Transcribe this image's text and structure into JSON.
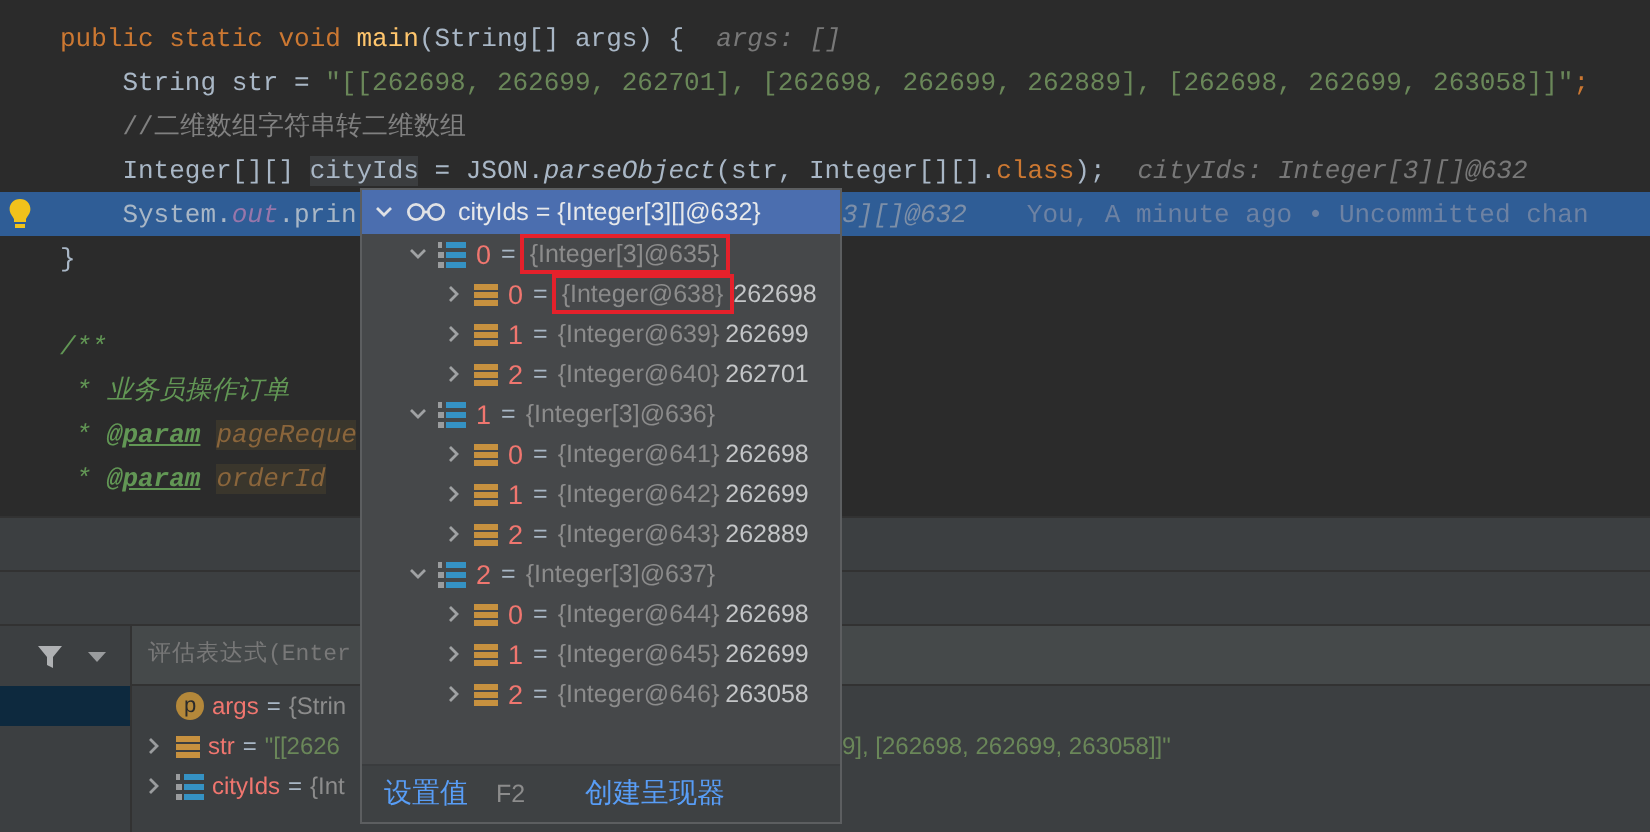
{
  "editor": {
    "lines": [
      {
        "current": false,
        "bulb": false,
        "segments": [
          {
            "text": "public static void ",
            "kind": "kw"
          },
          {
            "text": "main",
            "kind": "fn"
          },
          {
            "text": "(String[] args) {",
            "kind": "plain"
          },
          {
            "text": "args: []",
            "kind": "hint"
          }
        ]
      },
      {
        "current": false,
        "bulb": false,
        "segments": [
          {
            "text": "    String str = ",
            "kind": "plain"
          },
          {
            "text": "\"[[262698, 262699, 262701], [262698, 262699, 262889], [262698, 262699, 263058]]\"",
            "kind": "str"
          },
          {
            "text": ";",
            "kind": "kw"
          }
        ]
      },
      {
        "current": false,
        "bulb": false,
        "segments": [
          {
            "text": "    //二维数组字符串转二维数组",
            "kind": "comment"
          }
        ]
      },
      {
        "current": false,
        "bulb": false,
        "segments": [
          {
            "text": "    Integer[][] ",
            "kind": "plain"
          },
          {
            "text": "cityIds",
            "kind": "ref"
          },
          {
            "text": " = JSON.",
            "kind": "plain"
          },
          {
            "text": "parseObject",
            "kind": "italic"
          },
          {
            "text": "(str, Integer[][].",
            "kind": "plain"
          },
          {
            "text": "class",
            "kind": "kw"
          },
          {
            "text": ");",
            "kind": "plain"
          },
          {
            "text": "cityIds: Integer[3][]@632",
            "kind": "hint"
          }
        ]
      },
      {
        "current": true,
        "bulb": true,
        "segments": [
          {
            "text": "    System.",
            "kind": "plain"
          },
          {
            "text": "out",
            "kind": "field"
          },
          {
            "text": ".prin",
            "kind": "plain"
          }
        ],
        "right": [
          {
            "text": "3][]@632",
            "kind": "hint"
          },
          {
            "text": "You, A minute ago • Uncommitted chan",
            "kind": "blame"
          }
        ]
      },
      {
        "current": false,
        "bulb": false,
        "segments": [
          {
            "text": "}",
            "kind": "plain"
          }
        ]
      },
      {
        "current": false,
        "bulb": false,
        "segments": [
          {
            "text": "/**",
            "kind": "doc"
          }
        ]
      },
      {
        "current": false,
        "bulb": false,
        "segments": [
          {
            "text": " * 业务员操作订单",
            "kind": "doc"
          }
        ]
      },
      {
        "current": false,
        "bulb": false,
        "segments": [
          {
            "text": " * ",
            "kind": "doc"
          },
          {
            "text": "@param",
            "kind": "doctag"
          },
          {
            "text": "pageReque",
            "kind": "docparam"
          }
        ]
      },
      {
        "current": false,
        "bulb": false,
        "segments": [
          {
            "text": " * ",
            "kind": "doc"
          },
          {
            "text": "@param",
            "kind": "doctag"
          },
          {
            "text": "orderId",
            "kind": "docparam"
          }
        ]
      }
    ]
  },
  "debugger": {
    "evaluate": {
      "placeholder": "评估表达式(Enter"
    },
    "variables": [
      {
        "kind": "param",
        "icon_letter": "p",
        "name": "args",
        "eq": "=",
        "value": {
          "kind": "type",
          "text": "{Strin"
        },
        "expandable": false
      },
      {
        "kind": "field",
        "name": "str",
        "eq": "=",
        "value": {
          "kind": "str",
          "text": "\"[[2626"
        },
        "tail": "9], [262698, 262699, 263058]]\"",
        "expandable": true
      },
      {
        "kind": "array",
        "name": "cityIds",
        "eq": "=",
        "value": {
          "kind": "type",
          "text": "{Int"
        },
        "expandable": true
      }
    ]
  },
  "popup": {
    "header": {
      "label": "cityIds = {Integer[3][]@632}",
      "expanded": true
    },
    "nodes": [
      {
        "kind": "array",
        "index": "0",
        "eq": "=",
        "type": "{Integer[3]@635}",
        "expanded": true,
        "boxed": true,
        "children": [
          {
            "kind": "field",
            "index": "0",
            "eq": "=",
            "type": "{Integer@638}",
            "value": "262698",
            "expanded": false,
            "boxed": true
          },
          {
            "kind": "field",
            "index": "1",
            "eq": "=",
            "type": "{Integer@639}",
            "value": "262699",
            "expanded": false,
            "boxed": false
          },
          {
            "kind": "field",
            "index": "2",
            "eq": "=",
            "type": "{Integer@640}",
            "value": "262701",
            "expanded": false,
            "boxed": false
          }
        ]
      },
      {
        "kind": "array",
        "index": "1",
        "eq": "=",
        "type": "{Integer[3]@636}",
        "expanded": true,
        "boxed": false,
        "children": [
          {
            "kind": "field",
            "index": "0",
            "eq": "=",
            "type": "{Integer@641}",
            "value": "262698",
            "expanded": false,
            "boxed": false
          },
          {
            "kind": "field",
            "index": "1",
            "eq": "=",
            "type": "{Integer@642}",
            "value": "262699",
            "expanded": false,
            "boxed": false
          },
          {
            "kind": "field",
            "index": "2",
            "eq": "=",
            "type": "{Integer@643}",
            "value": "262889",
            "expanded": false,
            "boxed": false
          }
        ]
      },
      {
        "kind": "array",
        "index": "2",
        "eq": "=",
        "type": "{Integer[3]@637}",
        "expanded": true,
        "boxed": false,
        "children": [
          {
            "kind": "field",
            "index": "0",
            "eq": "=",
            "type": "{Integer@644}",
            "value": "262698",
            "expanded": false,
            "boxed": false
          },
          {
            "kind": "field",
            "index": "1",
            "eq": "=",
            "type": "{Integer@645}",
            "value": "262699",
            "expanded": false,
            "boxed": false
          },
          {
            "kind": "field",
            "index": "2",
            "eq": "=",
            "type": "{Integer@646}",
            "value": "263058",
            "expanded": false,
            "boxed": false
          }
        ]
      }
    ],
    "actions": [
      {
        "label": "设置值",
        "shortcut": "F2"
      },
      {
        "label": "创建呈现器"
      }
    ]
  }
}
